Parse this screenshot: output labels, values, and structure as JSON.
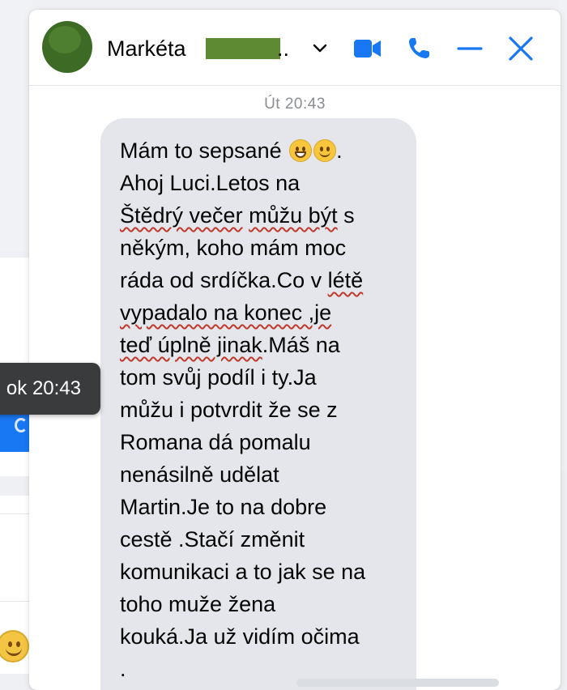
{
  "chat": {
    "contact_name": "Markéta",
    "name_suffix": "..",
    "colors": {
      "accent": "#1877f2",
      "bubble": "#e4e6eb",
      "tooltip": "#3a3b3c"
    },
    "header_icons": [
      "video-call-icon",
      "phone-call-icon",
      "minimize-icon",
      "close-icon"
    ]
  },
  "timestamp": "Út 20:43",
  "message": {
    "lines": [
      "Mám to sepsané",
      "Ahoj Luci.Letos na",
      "Štědrý večer",
      "můžu být",
      "s",
      "někým, koho mám moc",
      "ráda od srdíčka.Co v",
      "létě",
      "vypadalo na konec ,je",
      "teď úplně jinak",
      ".Máš na",
      "tom svůj podíl i ty.Ja",
      "můžu i potvrdit že se z",
      "Romana dá pomalu",
      "nenásilně udělat",
      "Martin.Je to na dobre",
      "cestě .Stačí změnit",
      "komunikaci a to jak se na",
      "toho muže žena",
      "kouká.Ja už vidím očima",
      "."
    ]
  },
  "tooltip": {
    "text": "ok 20:43"
  }
}
